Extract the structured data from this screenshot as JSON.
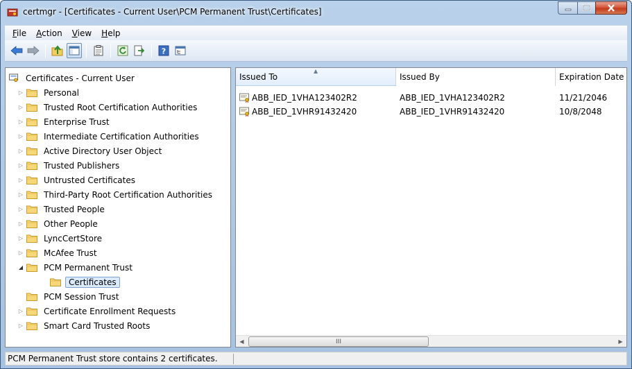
{
  "window": {
    "title": "certmgr - [Certificates - Current User\\PCM Permanent Trust\\Certificates]",
    "controls": {
      "minimize": "minimize",
      "maximize": "maximize",
      "close": "close"
    }
  },
  "menubar": {
    "items": [
      {
        "label": "File",
        "accel": "F"
      },
      {
        "label": "Action",
        "accel": "A"
      },
      {
        "label": "View",
        "accel": "V"
      },
      {
        "label": "Help",
        "accel": "H"
      }
    ]
  },
  "toolbar": {
    "buttons": [
      "back-icon",
      "forward-icon",
      "up-folder-icon",
      "show-hide-tree-icon",
      "properties-icon",
      "refresh-icon",
      "export-list-icon",
      "help-icon",
      "console-tree-icon"
    ]
  },
  "tree": {
    "root": "Certificates - Current User",
    "items": [
      {
        "label": "Personal",
        "expander": "collapsed"
      },
      {
        "label": "Trusted Root Certification Authorities",
        "expander": "collapsed"
      },
      {
        "label": "Enterprise Trust",
        "expander": "collapsed"
      },
      {
        "label": "Intermediate Certification Authorities",
        "expander": "collapsed"
      },
      {
        "label": "Active Directory User Object",
        "expander": "collapsed"
      },
      {
        "label": "Trusted Publishers",
        "expander": "collapsed"
      },
      {
        "label": "Untrusted Certificates",
        "expander": "collapsed"
      },
      {
        "label": "Third-Party Root Certification Authorities",
        "expander": "collapsed"
      },
      {
        "label": "Trusted People",
        "expander": "collapsed"
      },
      {
        "label": "Other People",
        "expander": "collapsed"
      },
      {
        "label": "LyncCertStore",
        "expander": "collapsed"
      },
      {
        "label": "McAfee Trust",
        "expander": "collapsed"
      },
      {
        "label": "PCM Permanent Trust",
        "expander": "expanded"
      },
      {
        "label": "Certificates",
        "expander": "none",
        "child": true,
        "selected": true
      },
      {
        "label": "PCM Session Trust",
        "expander": "none"
      },
      {
        "label": "Certificate Enrollment Requests",
        "expander": "collapsed"
      },
      {
        "label": "Smart Card Trusted Roots",
        "expander": "collapsed"
      }
    ]
  },
  "list": {
    "columns": [
      {
        "label": "Issued To",
        "sorted": true
      },
      {
        "label": "Issued By",
        "sorted": false
      },
      {
        "label": "Expiration Date",
        "sorted": false
      }
    ],
    "rows": [
      {
        "issued_to": "ABB_IED_1VHA123402R2",
        "issued_by": "ABB_IED_1VHA123402R2",
        "expiration": "11/21/2046"
      },
      {
        "issued_to": "ABB_IED_1VHR91432420",
        "issued_by": "ABB_IED_1VHR91432420",
        "expiration": "10/8/2048"
      }
    ],
    "scroll_thumb_grip": "III"
  },
  "statusbar": {
    "text": "PCM Permanent Trust store contains 2 certificates."
  }
}
